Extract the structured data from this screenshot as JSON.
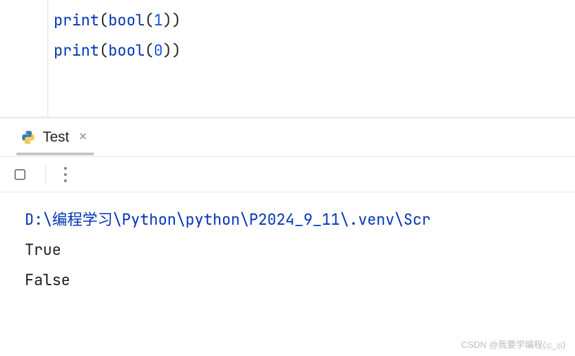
{
  "editor": {
    "lines": [
      {
        "func": "print",
        "inner_func": "bool",
        "arg": "1"
      },
      {
        "func": "print",
        "inner_func": "bool",
        "arg": "0"
      }
    ]
  },
  "panel": {
    "tab": {
      "label": "Test",
      "close_glyph": "×"
    }
  },
  "console": {
    "command": "D:\\编程学习\\Python\\python\\P2024_9_11\\.venv\\Scr",
    "output": [
      "True",
      "False"
    ]
  },
  "watermark": "CSDN @我要学编程(ಥ_ಥ)"
}
